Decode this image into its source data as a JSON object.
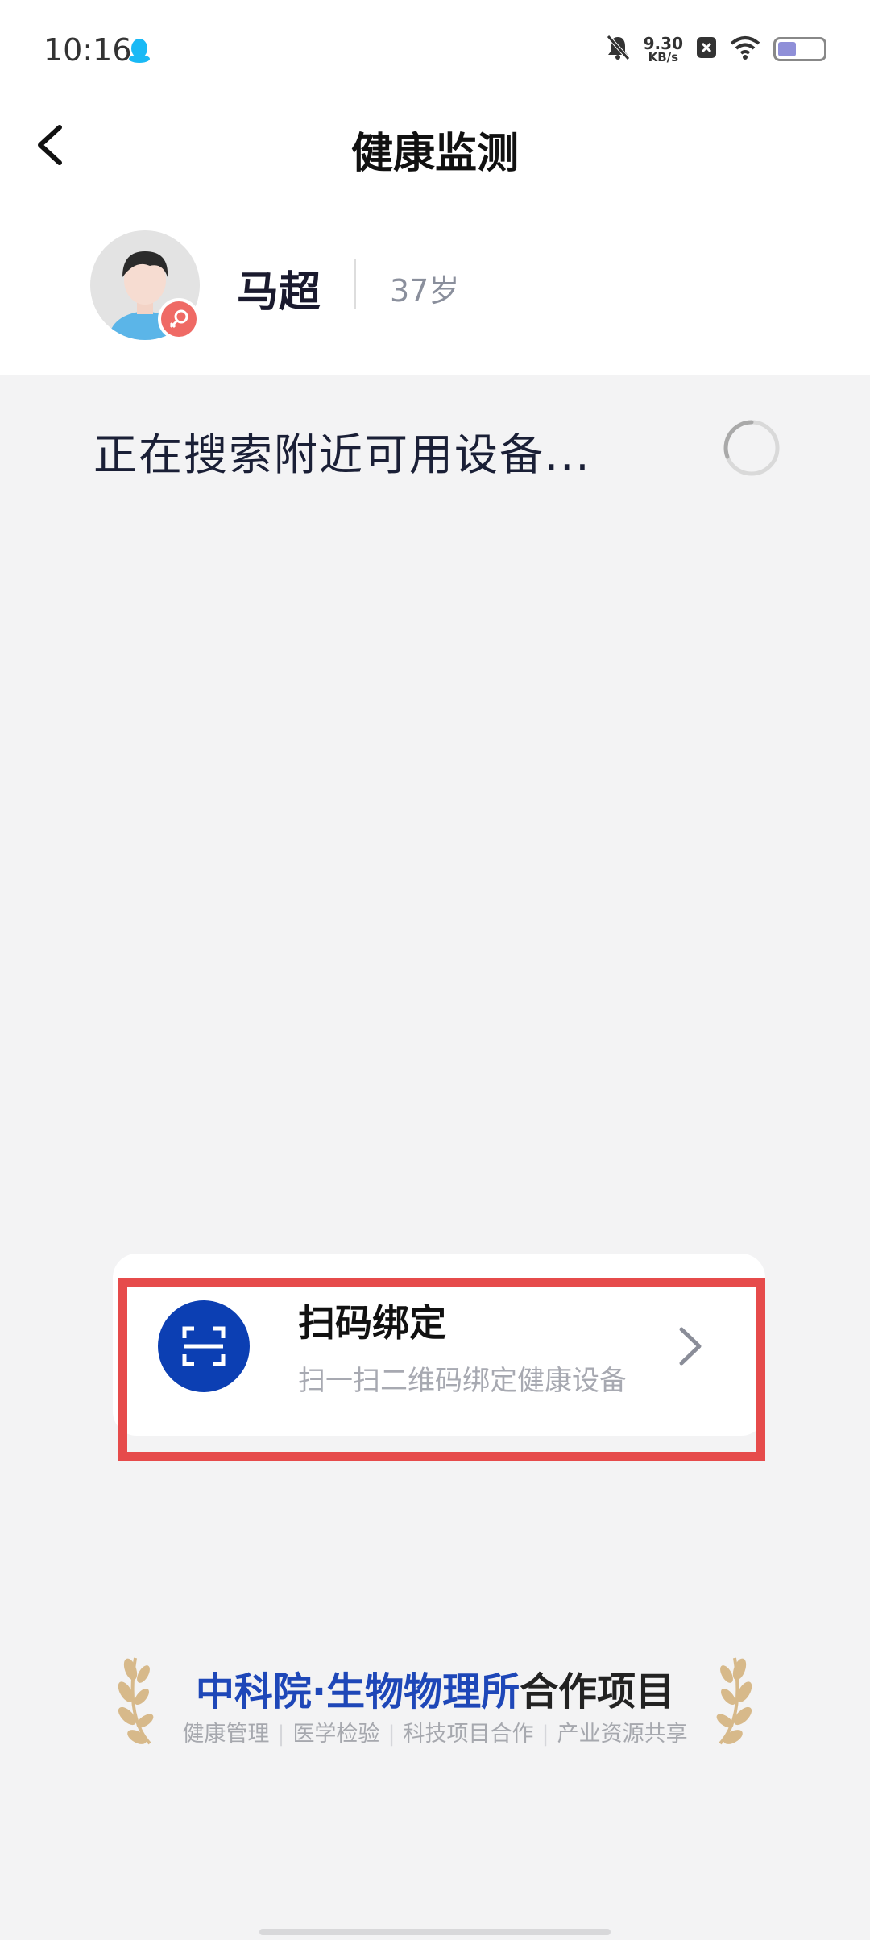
{
  "status_bar": {
    "time": "10:16",
    "net_speed_value": "9.30",
    "net_speed_unit": "KB/s",
    "icons": [
      "qq-icon",
      "mute-bell-icon",
      "close-box-icon",
      "wifi-icon",
      "battery-icon"
    ]
  },
  "header": {
    "title": "健康监测"
  },
  "profile": {
    "name": "马超",
    "age": "37岁",
    "gender_badge_color": "#ef6a65"
  },
  "search": {
    "status_text": "正在搜索附近可用设备..."
  },
  "scan_bind": {
    "title": "扫码绑定",
    "subtitle": "扫一扫二维码绑定健康设备",
    "icon_bg": "#0c3fb3",
    "highlight_color": "#e64b4b"
  },
  "footer": {
    "title_blue": "中科院·生物物理所",
    "title_dark": "合作项目",
    "tags": [
      "健康管理",
      "医学检验",
      "科技项目合作",
      "产业资源共享"
    ]
  }
}
